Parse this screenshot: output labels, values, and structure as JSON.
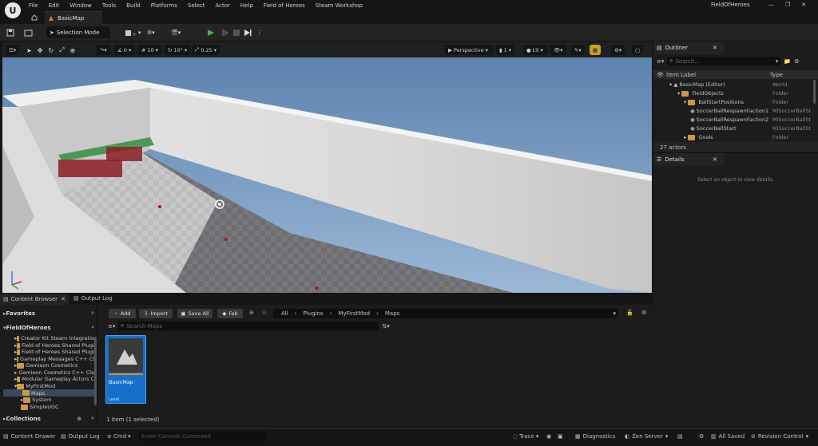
{
  "menu": [
    "File",
    "Edit",
    "Window",
    "Tools",
    "Build",
    "Platforms",
    "Select",
    "Actor",
    "Help",
    "Field of Heroes",
    "Steam Workshop"
  ],
  "project_name": "FieldOfHeroes",
  "map_tab": "BasicMap",
  "toolbar": {
    "selection_mode": "Selection Mode"
  },
  "viewport": {
    "snap_rotation": "0",
    "snap_grid": "10",
    "snap_angle": "10°",
    "snap_scale": "0.25",
    "perspective": "Perspective",
    "camera_speed": "1",
    "lit": "Lit"
  },
  "outliner": {
    "tab": "Outliner",
    "search_placeholder": "Search...",
    "col_label": "Item Label",
    "col_type": "Type",
    "rows": [
      {
        "label": "BasicMap (Editor)",
        "type": "World"
      },
      {
        "label": "FieldObjects",
        "type": "Folder"
      },
      {
        "label": "BallStartPositions",
        "type": "Folder"
      },
      {
        "label": "SoccerBallRespawnFaction1",
        "type": "MiSoccerBallSt"
      },
      {
        "label": "SoccerBallRespawnFaction2",
        "type": "MiSoccerBallSt"
      },
      {
        "label": "SoccerBallStart",
        "type": "MiSoccerBallSt"
      },
      {
        "label": "Goals",
        "type": "Folder"
      }
    ],
    "actor_count": "27 actors"
  },
  "details": {
    "tab": "Details",
    "empty_text": "Select an object to view details."
  },
  "content_browser": {
    "tab": "Content Browser",
    "output_tab": "Output Log",
    "favorites": "Favorites",
    "project_root": "FieldOfHeroes",
    "tree": [
      "Creator Kit Steam Integratio",
      "Field of Heroes Shared Plugi",
      "Field of Heroes Shared Plugi",
      "Gameplay Messages C++ Cl",
      "Gamieon Cosmetics",
      "Gamieon Cosmetics C++ Cla",
      "Modular Gameplay Actors C",
      "MyFirstMod",
      "Maps",
      "System",
      "SimpleUGC"
    ],
    "collections": "Collections",
    "add": "Add",
    "import": "Import",
    "save_all": "Save All",
    "fab": "Fab",
    "breadcrumb": [
      "All",
      "Plugins",
      "MyFirstMod",
      "Maps"
    ],
    "search_placeholder": "Search Maps",
    "asset_name": "BasicMap",
    "asset_type": "Level",
    "item_count": "1 item (1 selected)"
  },
  "statusbar": {
    "content_drawer": "Content Drawer",
    "output_log": "Output Log",
    "cmd": "Cmd",
    "console_placeholder": "Enter Console Command",
    "trace": "Trace",
    "diagnostics": "Diagnostics",
    "zen_server": "Zen Server",
    "all_saved": "All Saved",
    "revision_control": "Revision Control"
  }
}
